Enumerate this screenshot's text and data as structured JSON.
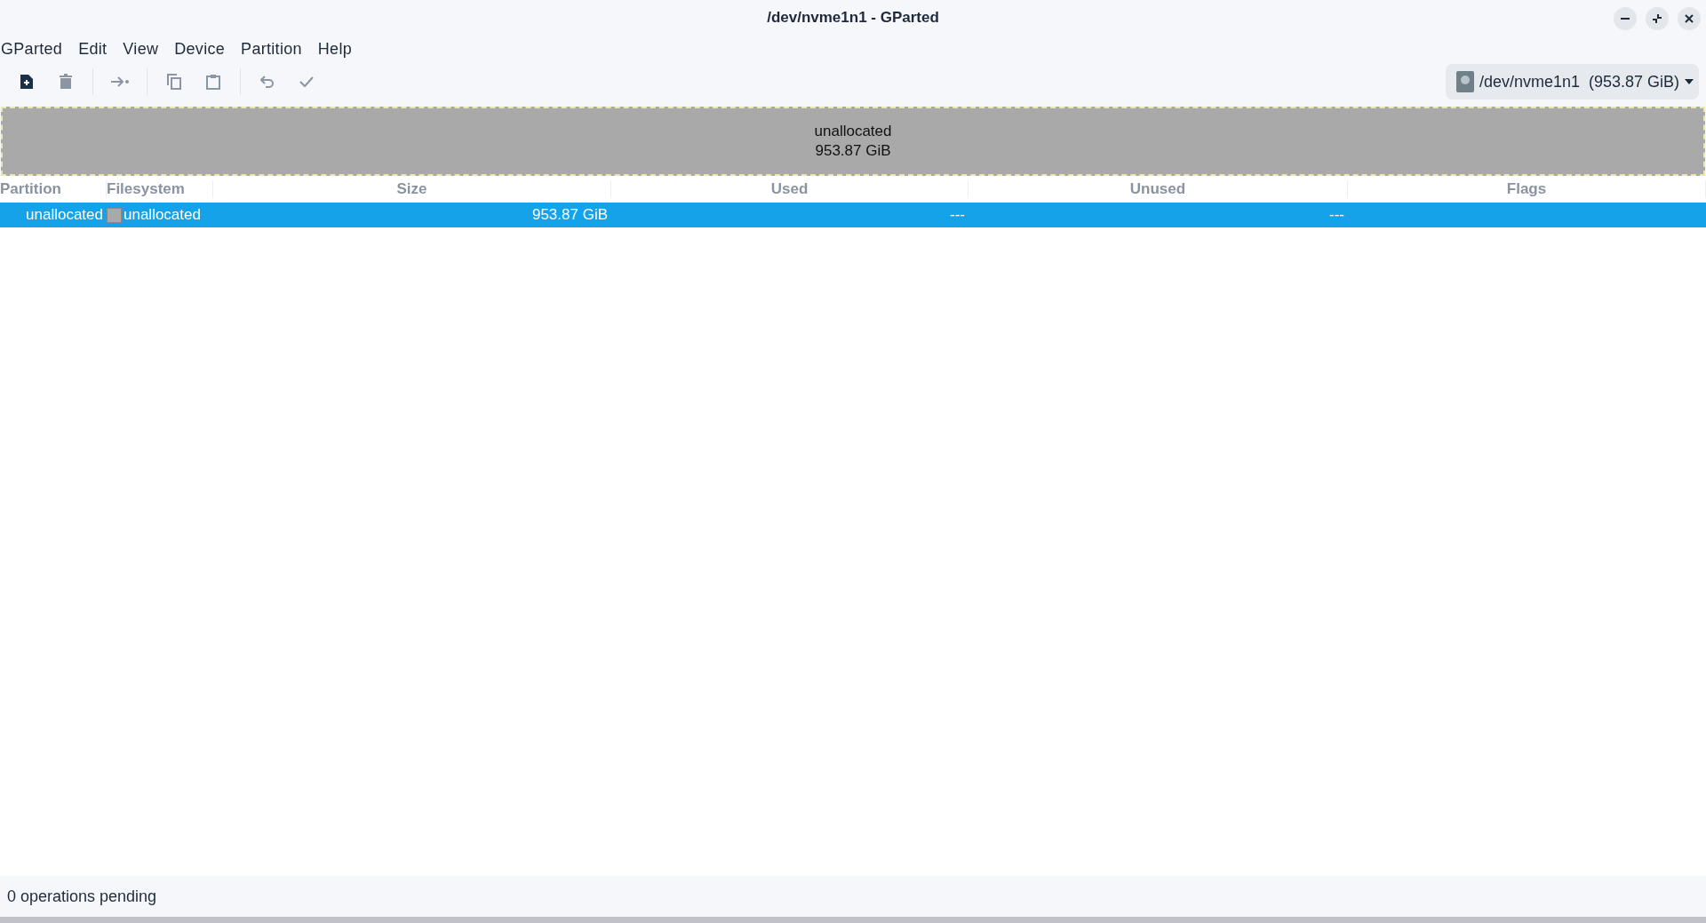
{
  "window": {
    "title": "/dev/nvme1n1 - GParted"
  },
  "menu": [
    "GParted",
    "Edit",
    "View",
    "Device",
    "Partition",
    "Help"
  ],
  "toolbar": [
    {
      "kind": "new",
      "disabled": false
    },
    {
      "kind": "delete",
      "disabled": true
    },
    {
      "kind": "sep"
    },
    {
      "kind": "resize",
      "disabled": true
    },
    {
      "kind": "sep"
    },
    {
      "kind": "copy",
      "disabled": true
    },
    {
      "kind": "paste",
      "disabled": true
    },
    {
      "kind": "sep"
    },
    {
      "kind": "undo",
      "disabled": true
    },
    {
      "kind": "apply",
      "disabled": true
    }
  ],
  "device_selector": {
    "label": "/dev/nvme1n1  (953.87 GiB)"
  },
  "disk_map": {
    "name": "unallocated",
    "size": "953.87 GiB"
  },
  "table": {
    "columns": [
      "Partition",
      "Filesystem",
      "Size",
      "Used",
      "Unused",
      "Flags"
    ],
    "rows": [
      {
        "partition": "unallocated",
        "filesystem": "unallocated",
        "size": "953.87 GiB",
        "used": "---",
        "unused": "---",
        "selected": true
      }
    ]
  },
  "status_bar": "0 operations pending"
}
